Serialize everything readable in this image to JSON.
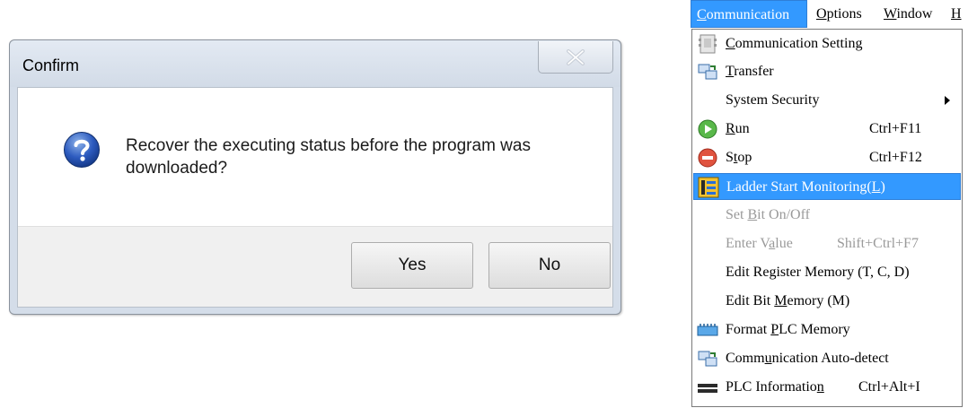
{
  "dialog": {
    "title": "Confirm",
    "message": "Recover the executing status before the program was downloaded?",
    "yes_label": "Yes",
    "no_label": "No",
    "icon": "question-icon",
    "close_icon": "close-icon"
  },
  "menubar": {
    "items": [
      {
        "pre": "",
        "key": "C",
        "post": "ommunication"
      },
      {
        "pre": "",
        "key": "O",
        "post": "ptions"
      },
      {
        "pre": "",
        "key": "W",
        "post": "indow"
      },
      {
        "pre": "",
        "key": "H",
        "post": ""
      }
    ]
  },
  "menu": {
    "items": [
      {
        "icon": "communication-setting-icon",
        "pre": "",
        "key": "C",
        "post": "ommunication Setting",
        "shortcut": ""
      },
      {
        "icon": "transfer-icon",
        "pre": "",
        "key": "T",
        "post": "ransfer",
        "shortcut": ""
      },
      {
        "icon": "",
        "pre": "System Security",
        "key": "",
        "post": "",
        "shortcut": ""
      },
      {
        "icon": "run-icon",
        "pre": "",
        "key": "R",
        "post": "un",
        "shortcut": "Ctrl+F11"
      },
      {
        "icon": "stop-icon",
        "pre": "S",
        "key": "t",
        "post": "op",
        "shortcut": "Ctrl+F12"
      },
      {
        "icon": "ladder-monitor-icon",
        "pre": "Ladder Start Monitoring(",
        "key": "L",
        "post": ")",
        "shortcut": ""
      },
      {
        "icon": "",
        "pre": "Set ",
        "key": "B",
        "post": "it On/Off",
        "shortcut": ""
      },
      {
        "icon": "",
        "pre": "Enter V",
        "key": "a",
        "post": "lue",
        "shortcut": "Shift+Ctrl+F7"
      },
      {
        "icon": "",
        "pre": "Edit Re",
        "key": "g",
        "post": "ister Memory (T, C, D)",
        "shortcut": ""
      },
      {
        "icon": "",
        "pre": "Edit Bit ",
        "key": "M",
        "post": "emory (M)",
        "shortcut": ""
      },
      {
        "icon": "format-memory-icon",
        "pre": "Format ",
        "key": "P",
        "post": "LC Memory",
        "shortcut": ""
      },
      {
        "icon": "auto-detect-icon",
        "pre": "Comm",
        "key": "u",
        "post": "nication Auto-detect",
        "shortcut": ""
      },
      {
        "icon": "plc-info-icon",
        "pre": "PLC Informatio",
        "key": "n",
        "post": "",
        "shortcut": "Ctrl+Alt+I"
      }
    ]
  },
  "colors": {
    "highlight": "#3399ff",
    "disabled_text": "#9a9a9a",
    "dialog_frame": "#d4dde9"
  }
}
